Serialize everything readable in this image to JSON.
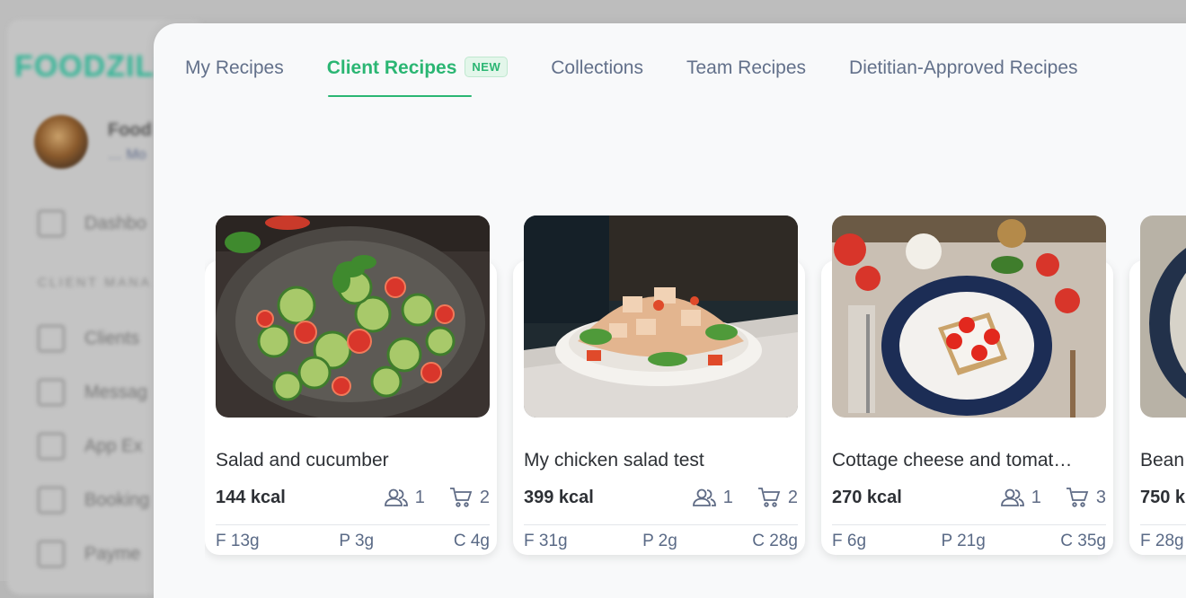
{
  "background": {
    "logo": "FOODZILLA",
    "user_name": "Food",
    "user_sub": "… Mo",
    "section_label": "CLIENT MANA",
    "menu": [
      "Dashbo",
      "Clients",
      "Messag",
      "App Ex",
      "Booking",
      "Payme"
    ]
  },
  "tabs": [
    {
      "label": "My Recipes"
    },
    {
      "label": "Client Recipes",
      "badge": "NEW"
    },
    {
      "label": "Collections"
    },
    {
      "label": "Team Recipes"
    },
    {
      "label": "Dietitian-Approved Recipes"
    }
  ],
  "recipes": [
    {
      "title": "Salad and cucumber",
      "kcal": "144 kcal",
      "clients": "1",
      "cart": "2",
      "fat": "F 13g",
      "protein": "P 3g",
      "carbs": "C 4g"
    },
    {
      "title": "My chicken salad test",
      "kcal": "399 kcal",
      "clients": "1",
      "cart": "2",
      "fat": "F 31g",
      "protein": "P 2g",
      "carbs": "C 28g"
    },
    {
      "title": "Cottage cheese and tomat…",
      "kcal": "270 kcal",
      "clients": "1",
      "cart": "3",
      "fat": "F 6g",
      "protein": "P 21g",
      "carbs": "C 35g"
    },
    {
      "title": "Bean",
      "kcal": "750 k",
      "clients": "",
      "cart": "",
      "fat": "F 28g",
      "protein": "",
      "carbs": ""
    }
  ],
  "colors": {
    "accent": "#2bb673",
    "text": "#2d3035",
    "muted": "#62708a"
  },
  "icons": {
    "clients": "users-icon",
    "cart": "cart-icon"
  }
}
